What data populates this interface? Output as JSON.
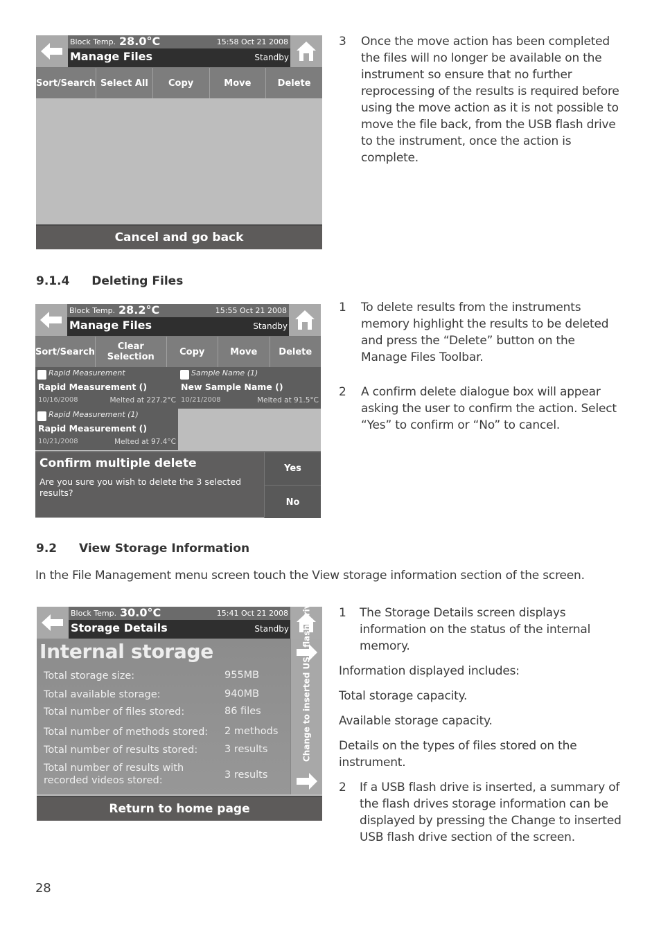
{
  "screen1": {
    "block_temp_label": "Block Temp.",
    "block_temp_value": "28.0°C",
    "datetime": "15:58 Oct 21 2008",
    "title": "Manage Files",
    "status": "Standby",
    "toolbar": [
      "Sort/Search",
      "Select All",
      "Copy",
      "Move",
      "Delete"
    ],
    "bottom_button": "Cancel and go back"
  },
  "step3": {
    "number": "3",
    "text": "Once the move action has been completed the files will no longer be available on the instrument so ensure that no further reprocessing of the results is required before using the move action as it is not possible to move the file back, from the USB flash drive to the instrument, once the action is complete."
  },
  "section_914": {
    "number": "9.1.4",
    "title": "Deleting Files"
  },
  "screen2": {
    "block_temp_label": "Block Temp.",
    "block_temp_value": "28.2°C",
    "datetime": "15:55 Oct 21 2008",
    "title": "Manage Files",
    "status": "Standby",
    "toolbar": [
      "Sort/Search",
      "Clear Selection",
      "Copy",
      "Move",
      "Delete"
    ],
    "files": [
      {
        "type": "Rapid Measurement",
        "name": "Rapid Measurement ()",
        "date": "10/16/2008",
        "melt": "Melted at 227.2°C"
      },
      {
        "type": "Sample Name (1)",
        "name": "New Sample Name ()",
        "date": "10/21/2008",
        "melt": "Melted at 91.5°C"
      },
      {
        "type": "Rapid Measurement (1)",
        "name": "Rapid Measurement ()",
        "date": "10/21/2008",
        "melt": "Melted at 97.4°C"
      }
    ],
    "dialog": {
      "title": "Confirm multiple delete",
      "message": "Are you sure you wish to delete the 3 selected results?",
      "yes": "Yes",
      "no": "No"
    }
  },
  "delete_steps": [
    {
      "number": "1",
      "text": "To delete results from the instruments memory highlight the results to be deleted and press the “Delete” button on the Manage Files Toolbar."
    },
    {
      "number": "2",
      "text": "A confirm delete dialogue box will appear asking the user to confirm the action. Select “Yes” to confirm or “No” to cancel."
    }
  ],
  "section_92": {
    "number": "9.2",
    "title": "View Storage Information",
    "intro": "In the File Management menu screen touch the View storage information section of the screen."
  },
  "screen3": {
    "block_temp_label": "Block Temp.",
    "block_temp_value": "30.0°C",
    "datetime": "15:41 Oct 21 2008",
    "title": "Storage Details",
    "status": "Standby",
    "heading": "Internal storage",
    "rows": [
      {
        "label": "Total storage size:",
        "value": "955MB"
      },
      {
        "label": "Total available storage:",
        "value": "940MB"
      },
      {
        "label": "Total number of files stored:",
        "value": "86 files"
      },
      {
        "label": "Total number of methods stored:",
        "value": "2 methods"
      },
      {
        "label": "Total number of results stored:",
        "value": "3 results"
      },
      {
        "label": "Total number of results with recorded videos stored:",
        "value": "3 results"
      }
    ],
    "usb_button": "Change to inserted USB flash drive",
    "bottom_button": "Return to home page"
  },
  "storage_text": {
    "step1_number": "1",
    "step1": "The Storage Details screen displays information on the status of the internal memory.",
    "info_intro": "Information displayed includes:",
    "info_items": [
      "Total storage capacity.",
      "Available storage capacity.",
      "Details on the types of files stored on the instrument."
    ],
    "step2_number": "2",
    "step2": "If a USB flash drive is inserted, a summary of the flash drives storage information can be displayed by pressing the Change to inserted USB flash drive section of the screen."
  },
  "page_number": "28"
}
